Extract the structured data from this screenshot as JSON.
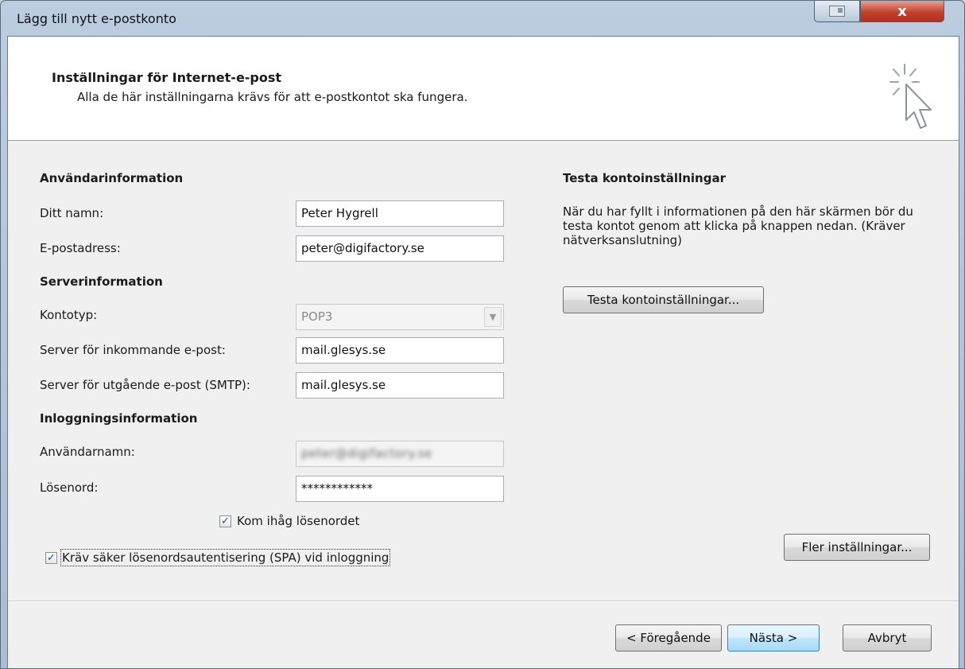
{
  "window": {
    "title": "Lägg till nytt e-postkonto",
    "close_glyph": "x"
  },
  "header": {
    "title": "Inställningar för Internet-e-post",
    "subtitle": "Alla de här inställningarna krävs för att e-postkontot ska fungera."
  },
  "user_info": {
    "heading": "Användarinformation",
    "name_label": "Ditt namn:",
    "name_value": "Peter Hygrell",
    "email_label": "E-postadress:",
    "email_value": "peter@digifactory.se"
  },
  "server_info": {
    "heading": "Serverinformation",
    "account_type_label": "Kontotyp:",
    "account_type_value": "POP3",
    "incoming_label": "Server för inkommande e-post:",
    "incoming_value": "mail.glesys.se",
    "outgoing_label": "Server för utgående e-post (SMTP):",
    "outgoing_value": "mail.glesys.se"
  },
  "login_info": {
    "heading": "Inloggningsinformation",
    "username_label": "Användarnamn:",
    "username_value": "peter@digifactory.se",
    "password_label": "Lösenord:",
    "password_value": "************",
    "remember_label": "Kom ihåg lösenordet",
    "remember_checked": true,
    "spa_label": "Kräv säker lösenordsautentisering (SPA) vid inloggning",
    "spa_checked": true
  },
  "test": {
    "heading": "Testa kontoinställningar",
    "description": "När du har fyllt i informationen på den här skärmen bör du testa kontot genom att klicka på knappen nedan. (Kräver nätverksanslutning)",
    "button_label": "Testa kontoinställningar..."
  },
  "more_settings_label": "Fler inställningar...",
  "footer": {
    "back_label": "< Föregående",
    "next_label": "Nästa >",
    "cancel_label": "Avbryt"
  },
  "colors": {
    "window_frame": "#b4c6da",
    "close_button": "#c4402d",
    "default_button_border": "#3c7fb1"
  },
  "icons": {
    "wizard": "cursor-sparkle-icon",
    "dropdown": "chevron-down-icon",
    "check": "checkmark-icon"
  }
}
